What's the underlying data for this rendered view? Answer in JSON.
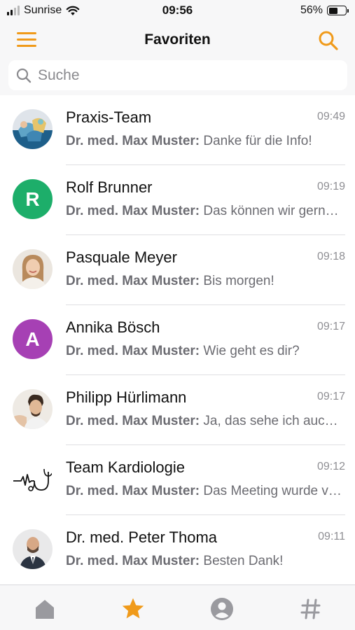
{
  "status_bar": {
    "carrier": "Sunrise",
    "time": "09:56",
    "battery_percent": "56%",
    "battery_level": 0.56,
    "signal_bars": 2
  },
  "header": {
    "title": "Favoriten",
    "menu_icon": "hamburger-menu-icon",
    "search_icon": "search-icon"
  },
  "search": {
    "placeholder": "Suche"
  },
  "colors": {
    "accent": "#f09a1a",
    "avatar_green": "#1dae6a",
    "avatar_purple": "#a640b4",
    "inactive_tab": "#9a9a9f"
  },
  "chats": [
    {
      "name": "Praxis-Team",
      "time": "09:49",
      "sender": "Dr. med. Max Muster:",
      "message": "Danke für die Info!",
      "avatar": "group-photo"
    },
    {
      "name": "Rolf Brunner",
      "time": "09:19",
      "sender": "Dr. med. Max Muster:",
      "message": "Das können wir gerne so machen",
      "avatar_letter": "R"
    },
    {
      "name": "Pasquale Meyer",
      "time": "09:18",
      "sender": "Dr. med. Max Muster:",
      "message": "Bis morgen!",
      "avatar": "woman-photo"
    },
    {
      "name": "Annika Bösch",
      "time": "09:17",
      "sender": "Dr. med. Max Muster:",
      "message": "Wie geht es dir?",
      "avatar_letter": "A"
    },
    {
      "name": "Philipp Hürlimann",
      "time": "09:17",
      "sender": "Dr. med. Max Muster:",
      "message": "Ja, das sehe ich auch so",
      "avatar": "man-photo"
    },
    {
      "name": "Team Kardiologie",
      "time": "09:12",
      "sender": "Dr. med. Max Muster:",
      "message": "Das Meeting wurde verschoben",
      "avatar": "stethoscope-heartbeat-logo"
    },
    {
      "name": "Dr. med. Peter Thoma",
      "time": "09:11",
      "sender": "Dr. med. Max Muster:",
      "message": "Besten Dank!",
      "avatar": "man-suit-photo"
    }
  ],
  "tab_bar": {
    "tabs": [
      {
        "icon": "home-icon",
        "active": false
      },
      {
        "icon": "star-icon",
        "active": true
      },
      {
        "icon": "profile-icon",
        "active": false
      },
      {
        "icon": "hashtag-icon",
        "active": false
      }
    ]
  }
}
